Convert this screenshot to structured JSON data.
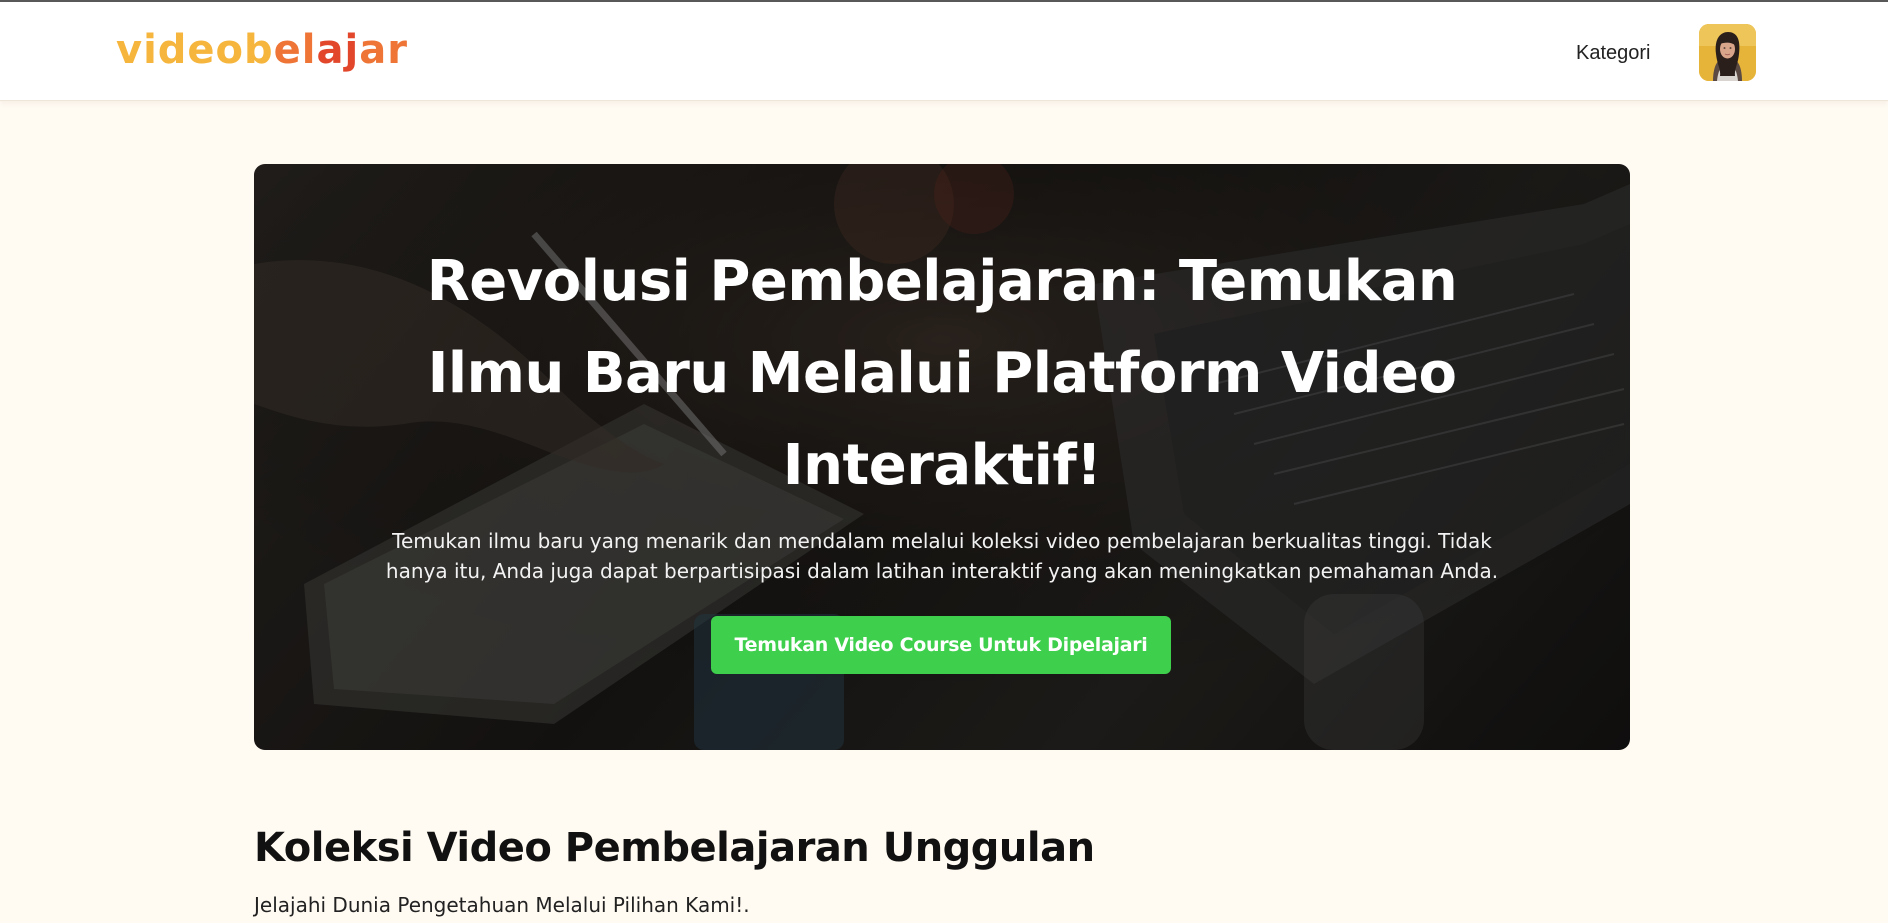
{
  "header": {
    "logo": {
      "part1": "videob",
      "part2": "el",
      "part3": "aj",
      "part4": "ar"
    },
    "nav": {
      "kategori": "Kategori"
    },
    "avatar_icon": "user-avatar-photo"
  },
  "hero": {
    "title": "Revolusi Pembelajaran: Temukan Ilmu Baru Melalui Platform Video Interaktif!",
    "description": "Temukan ilmu baru yang menarik dan mendalam melalui koleksi video pembelajaran berkualitas tinggi. Tidak hanya itu, Anda juga dapat berpartisipasi dalam latihan interaktif yang akan meningkatkan pemahaman Anda.",
    "cta_label": "Temukan Video Course Untuk Dipelajari",
    "background_image": "laptop-notebook-writing-photo"
  },
  "collection": {
    "title": "Koleksi Video Pembelajaran Unggulan",
    "subtitle": "Jelajahi Dunia Pengetahuan Melalui Pilihan Kami!."
  },
  "colors": {
    "page_background": "#FFFAF2",
    "logo_yellow": "#F6B53C",
    "logo_orange": "#EE7536",
    "logo_red": "#E2472C",
    "cta_green": "#3ECF4C"
  }
}
